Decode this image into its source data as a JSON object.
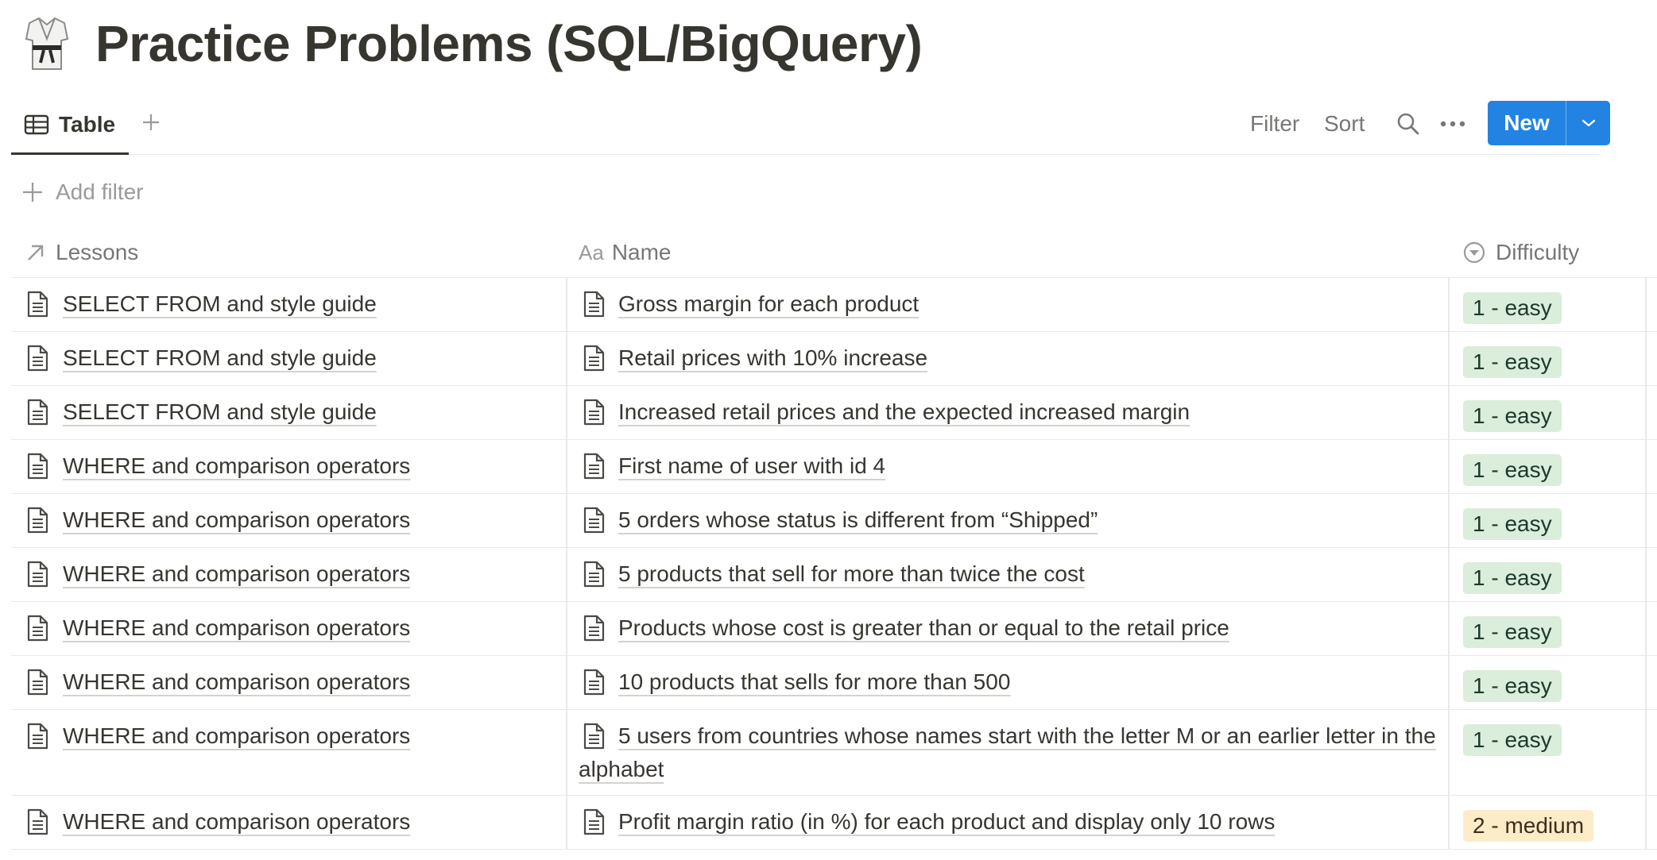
{
  "page": {
    "title": "Practice Problems (SQL/BigQuery)",
    "icon": "karate-gi-icon"
  },
  "viewbar": {
    "active_tab": "Table",
    "filter_label": "Filter",
    "sort_label": "Sort",
    "new_label": "New",
    "accent_color": "#2383e2"
  },
  "filters": {
    "add_filter_label": "Add filter"
  },
  "table": {
    "columns": [
      {
        "label": "Lessons",
        "icon": "relation-arrow-icon"
      },
      {
        "label": "Name",
        "icon": "title-aa-icon"
      },
      {
        "label": "Difficulty",
        "icon": "select-chevron-icon"
      }
    ],
    "rows": [
      {
        "lesson": "SELECT FROM and style guide",
        "name": "Gross margin for each product",
        "difficulty": "1 - easy",
        "level": "easy"
      },
      {
        "lesson": "SELECT FROM and style guide",
        "name": "Retail prices with 10% increase",
        "difficulty": "1 - easy",
        "level": "easy"
      },
      {
        "lesson": "SELECT FROM and style guide",
        "name": "Increased retail prices and the expected increased margin",
        "difficulty": "1 - easy",
        "level": "easy"
      },
      {
        "lesson": "WHERE and comparison operators",
        "name": "First name of user with id 4",
        "difficulty": "1 - easy",
        "level": "easy"
      },
      {
        "lesson": "WHERE and comparison operators",
        "name": "5 orders whose status is different from “Shipped”",
        "difficulty": "1 - easy",
        "level": "easy"
      },
      {
        "lesson": "WHERE and comparison operators",
        "name": "5 products that sell for more than twice the cost",
        "difficulty": "1 - easy",
        "level": "easy"
      },
      {
        "lesson": "WHERE and comparison operators",
        "name": "Products whose cost is greater than or equal to the retail price",
        "difficulty": "1 - easy",
        "level": "easy"
      },
      {
        "lesson": "WHERE and comparison operators",
        "name": "10 products that sells for more than 500",
        "difficulty": "1 - easy",
        "level": "easy"
      },
      {
        "lesson": "WHERE and comparison operators",
        "name": "5 users from countries whose names start with the letter M or an earlier letter in the alphabet",
        "difficulty": "1 - easy",
        "level": "easy"
      },
      {
        "lesson": "WHERE and comparison operators",
        "name": "Profit margin ratio (in %) for each product and display only 10 rows",
        "difficulty": "2 - medium",
        "level": "medium"
      }
    ]
  },
  "colors": {
    "easy_bg": "#dbeddb",
    "medium_bg": "#fdecc8",
    "divider": "#e9e9e7"
  }
}
